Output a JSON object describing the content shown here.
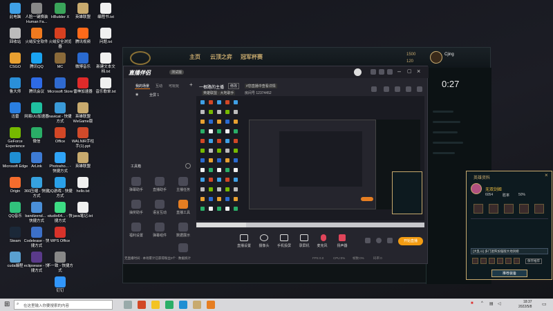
{
  "desktop_icons": [
    {
      "label": "此电脑",
      "color": "#3fa0e6"
    },
    {
      "label": "回收站",
      "color": "#bcbcbc"
    },
    {
      "label": "CSGO",
      "color": "#e8a030"
    },
    {
      "label": "鲁大师",
      "color": "#2a8fd8"
    },
    {
      "label": "迅雷",
      "color": "#2a7ee0"
    },
    {
      "label": "GeForce Experience",
      "color": "#76b900"
    },
    {
      "label": "Microsoft Edge",
      "color": "#1f8fd3"
    },
    {
      "label": "Origin",
      "color": "#f56c2d"
    },
    {
      "label": "QQ音乐",
      "color": "#31c27c"
    },
    {
      "label": "Steam",
      "color": "#1b2838"
    },
    {
      "label": "cuda编程",
      "color": "#5aa0d0"
    },
    {
      "label": "人脸一键换装 Human Fa...",
      "color": "#888"
    },
    {
      "label": "火绒安全软件",
      "color": "#f07a1f"
    },
    {
      "label": "腾讯QQ",
      "color": "#1aa3f0"
    },
    {
      "label": "腾讯会议",
      "color": "#2e6be6"
    },
    {
      "label": "网易UU加速器",
      "color": "#1fc0a0"
    },
    {
      "label": "微信",
      "color": "#2aae67"
    },
    {
      "label": "ArLink",
      "color": "#3d7bd4"
    },
    {
      "label": "360压缩 - 快捷方式",
      "color": "#36a2e0"
    },
    {
      "label": "bandizend... - 快捷方式",
      "color": "#4a8fd8"
    },
    {
      "label": "Codelease - 快捷方式",
      "color": "#3c70c8"
    },
    {
      "label": "eclipsease - 快捷方式",
      "color": "#5a3a8a"
    },
    {
      "label": "HBuilder X",
      "color": "#3aa55a"
    },
    {
      "label": "火绒安全浏览器",
      "color": "#d84020"
    },
    {
      "label": "MC",
      "color": "#8a6a3a"
    },
    {
      "label": "Microsoft Store",
      "color": "#2f6ad0"
    },
    {
      "label": "navicat - 快捷方式",
      "color": "#3a9ad8"
    },
    {
      "label": "Office",
      "color": "#d24726"
    },
    {
      "label": "Photosho... - 快捷方式",
      "color": "#2fa3f7"
    },
    {
      "label": "QQ游戏 - 快捷方式",
      "color": "#2aa0e8"
    },
    {
      "label": "studio64... - 快捷方式",
      "color": "#3ddc84"
    },
    {
      "label": "WPS Office",
      "color": "#d8322a"
    },
    {
      "label": "不一致 - 快捷方式",
      "color": "#888"
    },
    {
      "label": "钉钉",
      "color": "#3196fa"
    },
    {
      "label": "英雄联盟",
      "color": "#c8aa6e"
    },
    {
      "label": "腾讯视频",
      "color": "#ff6a1a"
    },
    {
      "label": "微博音乐",
      "color": "#2a6ad0"
    },
    {
      "label": "雷神加速器",
      "color": "#e02a2a"
    },
    {
      "label": "英雄联盟 WeGame版",
      "color": "#c8aa6e"
    },
    {
      "label": "WALNIR手柱 手(1).ppt",
      "color": "#d04a2a"
    },
    {
      "label": "英雄联盟",
      "color": "#c8aa6e"
    },
    {
      "label": "hello.txt",
      "color": "#f0f0f0"
    },
    {
      "label": "java笔记.txt",
      "color": "#f0f0f0"
    },
    {
      "label": "编程书.txt",
      "color": "#f0f0f0"
    },
    {
      "label": "问题.txt",
      "color": "#f0f0f0"
    },
    {
      "label": "新建文本文档.txt",
      "color": "#f0f0f0"
    },
    {
      "label": "音乐歌单.txt",
      "color": "#f0f0f0"
    }
  ],
  "lol": {
    "nav": [
      "主页",
      "云顶之弈",
      "冠军杯赛"
    ],
    "currency": [
      "1500",
      "120"
    ],
    "username": "Cjing",
    "timer": "0:27"
  },
  "stream": {
    "app_name": "直播伴侣",
    "badge": "测试版",
    "left_tabs": [
      "我的场景",
      "互动",
      "可玩玩"
    ],
    "scene_name": "全屏 1",
    "tools_title": "工具箱",
    "tools": [
      "弹幕助手",
      "直播助手",
      "主播任务",
      "抽奖助手",
      "语言互动",
      "直播工具",
      "福利设置",
      "弹幕组件",
      "数据展示",
      "直播声音"
    ],
    "room_title": "一根路的主播",
    "room_tag": "修改",
    "room_subtitle": "#您直播中查看详情",
    "room_game": "英雄联盟 · 大地歌手",
    "room_id": "房间号 12374452",
    "bottom_tools": [
      "直播设置",
      "摄像头",
      "手机投屏",
      "录屏机",
      "麦克风",
      "扬声器"
    ],
    "start_button": "开始直播",
    "status_text": "无直播时间 · 本场累计已获得粉丝0个 · 数据统计",
    "status_metrics": [
      "FPS 0.0",
      "CPU:0%",
      "帧数:0%",
      "码率:0"
    ]
  },
  "popup": {
    "title": "英雄资料",
    "champion": "无双剑姬",
    "stats": [
      "6054",
      "胜率",
      "50%"
    ],
    "dropdown": "[大乱斗] 多门迷阵加强版大地剑姬",
    "save_btn": "保存推荐",
    "apply_btn": "推荐装备"
  },
  "taskbar": {
    "search_placeholder": "在这里输入你要搜索的内容",
    "time": "18:37",
    "date": "2022/5/8"
  }
}
